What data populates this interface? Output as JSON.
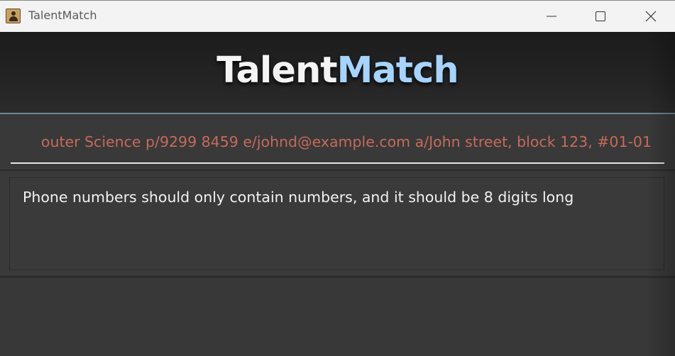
{
  "window": {
    "title": "TalentMatch",
    "icon": "address-book-icon",
    "controls": [
      "minimize-icon",
      "maximize-icon",
      "close-icon"
    ]
  },
  "header": {
    "title_part1": "Talent",
    "title_part2": "Match"
  },
  "command_box": {
    "value": "outer Science p/9299 8459 e/johnd@example.com a/John street, block 123, #01-01",
    "text_color": "#c66a5a"
  },
  "result_display": {
    "message": "Phone numbers should only contain numbers, and it should be 8 digits long"
  },
  "colors": {
    "background": "#383838",
    "title_accent": "#a6d4ff",
    "header_line": "#6d8797"
  }
}
